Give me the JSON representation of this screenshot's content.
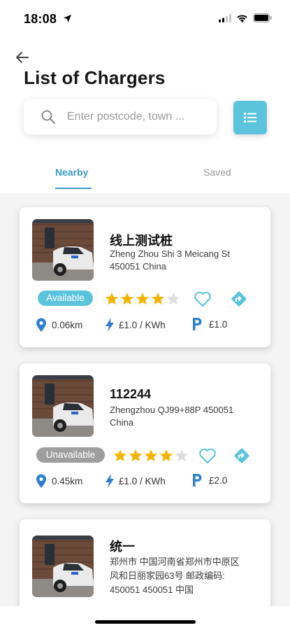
{
  "status_bar": {
    "time": "18:08"
  },
  "header": {
    "title": "List of Chargers"
  },
  "search": {
    "placeholder": "Enter postcode, town ..."
  },
  "tabs": [
    {
      "label": "Nearby",
      "active": true
    },
    {
      "label": "Saved",
      "active": false
    }
  ],
  "colors": {
    "accent": "#5bc4dc",
    "tab_active": "#3d9ac4",
    "star": "#f4b400",
    "pin": "#2f7fd0",
    "unavailable": "#9e9e9e"
  },
  "chargers": [
    {
      "name": "线上测试桩",
      "address_lines": [
        "Zheng Zhou Shi 3 Meicang St",
        "450051 China"
      ],
      "status": "Available",
      "rating": 4,
      "distance": "0.06km",
      "energy_price": "£1.0 / KWh",
      "parking_price": "£1.0"
    },
    {
      "name": "112244",
      "address_lines": [
        "Zhengzhou QJ99+88P 450051",
        "China"
      ],
      "status": "Unavailable",
      "rating": 4,
      "distance": "0.45km",
      "energy_price": "£1.0 / KWh",
      "parking_price": "£2.0"
    },
    {
      "name": "统一",
      "address_lines": [
        "郑州市 中国河南省郑州市中原区",
        "风和日丽家园63号 邮政编码:",
        "450051 450051 中国"
      ]
    }
  ],
  "icons": {
    "back": "arrow-left-icon",
    "search": "search-icon",
    "list": "list-icon",
    "favorite": "heart-outline-icon",
    "directions": "directions-icon",
    "location": "location-pin-icon",
    "energy": "lightning-icon",
    "parking": "parking-icon"
  }
}
